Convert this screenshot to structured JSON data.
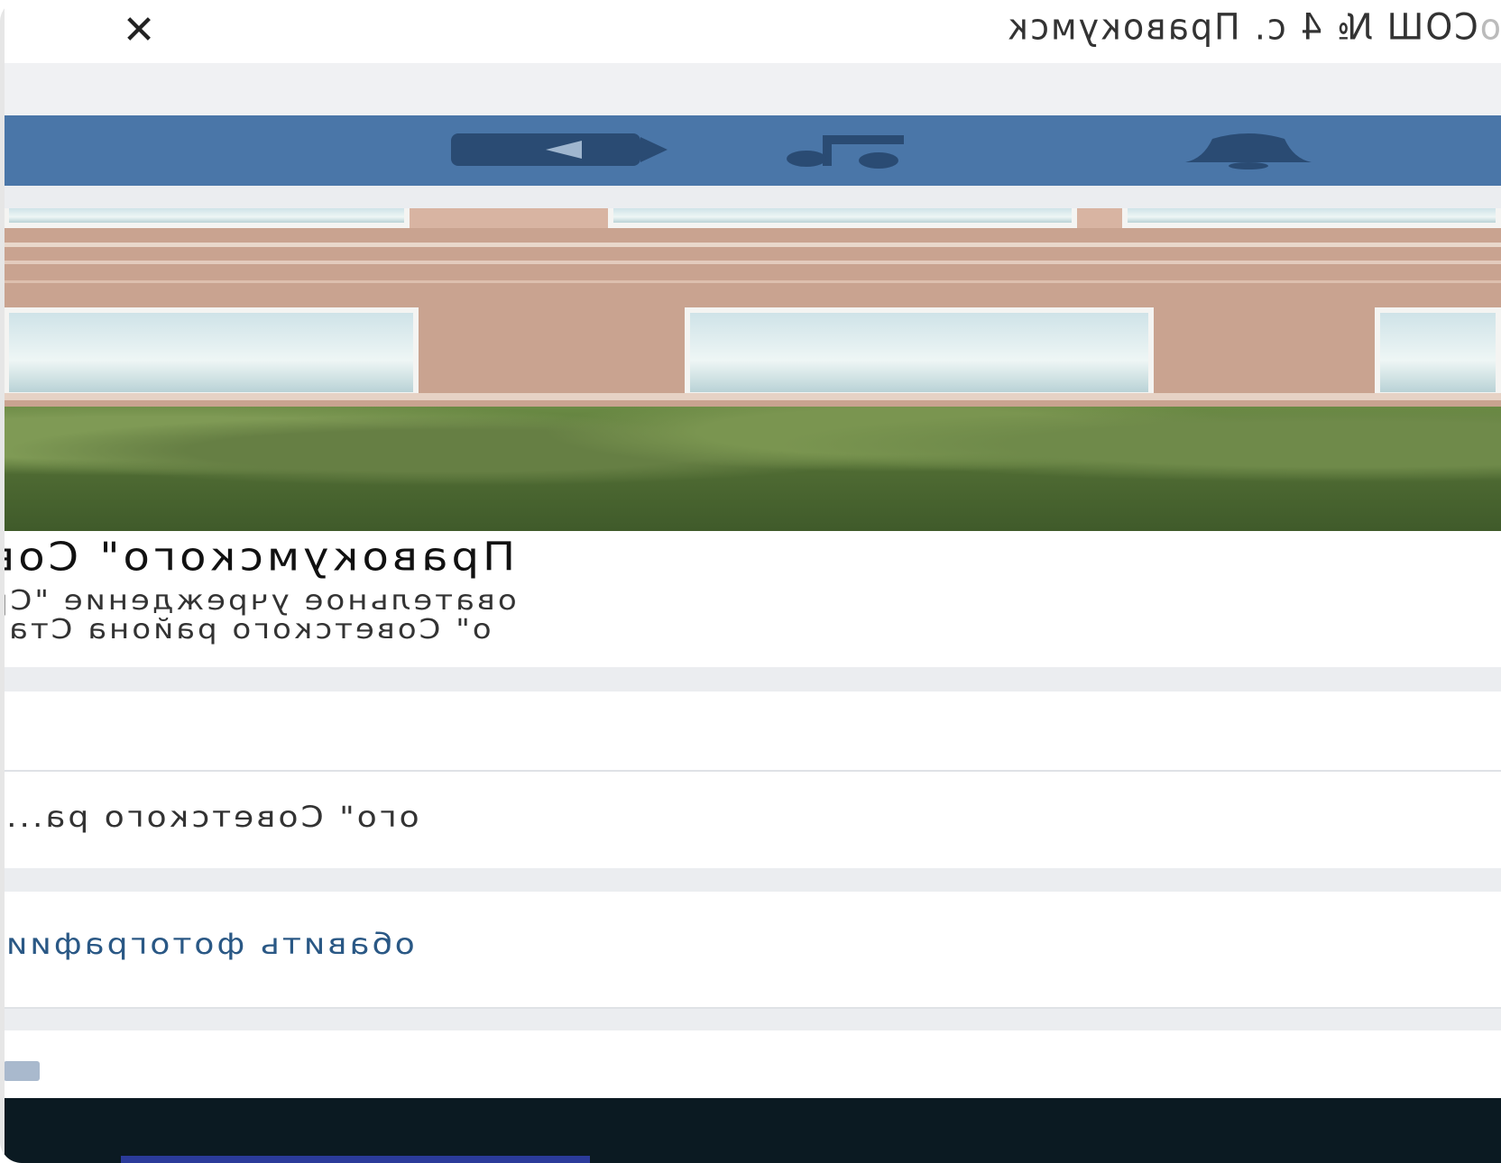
{
  "window": {
    "title_main": "СОШ № 4 с. Правокумск",
    "title_fade": "о",
    "close_label": "✕"
  },
  "navbar": {
    "icons": [
      "bell-icon",
      "music-icon",
      "video-icon"
    ],
    "music_glyph": "♫"
  },
  "group": {
    "name": "Правокумского\" Сов",
    "description_line1": "овательное учреждение \"Ср",
    "description_line2": "о\" Советского района Став"
  },
  "rows": {
    "info_text": "ого\" Советского ра...",
    "add_photo_label": "обавить фотографии"
  },
  "colors": {
    "nav_bg": "#4a76a8",
    "link": "#2a5885",
    "footer_bg": "#0b1a22"
  }
}
